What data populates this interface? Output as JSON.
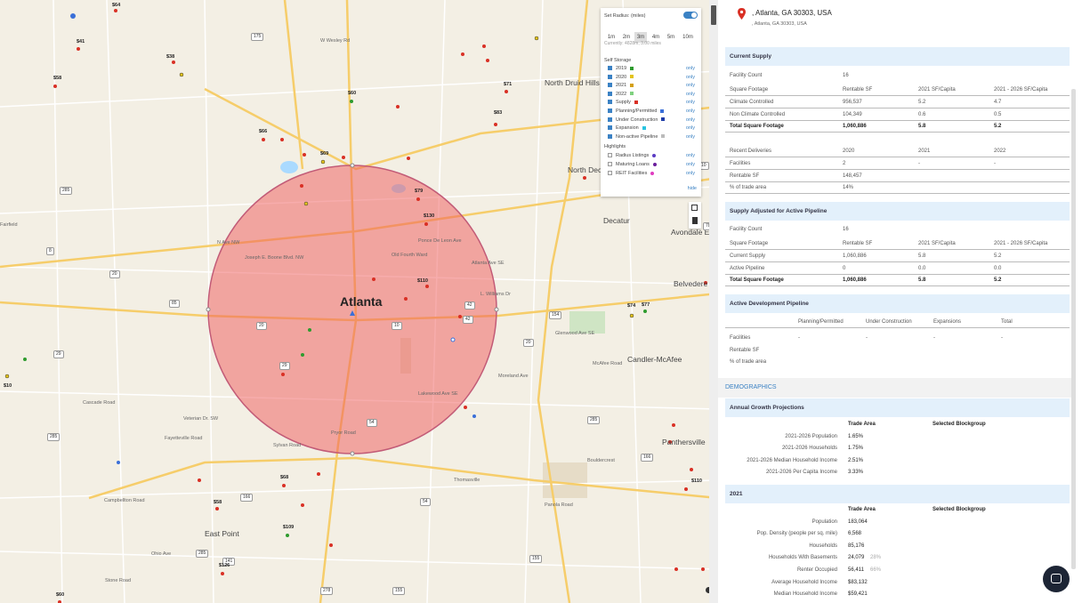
{
  "map": {
    "city_label": "Atlanta",
    "town_labels": [
      "North Druid Hills",
      "North Decat",
      "Decatur",
      "Avondale Estate",
      "Belvedere Park",
      "Candler-McAfee",
      "Panthersville",
      "East Point"
    ],
    "road_labels": [
      "W Wesley Rd",
      "N Ave NW",
      "Joseph E. Boone Blvd. NW",
      "Cascade Road",
      "Veterian Dr. SW",
      "Campbellton Road",
      "Stone Road",
      "Fairfield",
      "Lakewood Ave SE",
      "Ponce De Leon Ave",
      "Glenwood Ave SE",
      "McAfee Road",
      "Panola Road",
      "Atlanta Ave SE",
      "L. Williams Dr",
      "Old Fourth Ward",
      "Sylvan Road",
      "Pryor Road",
      "Thomasville",
      "Fayetteville Road",
      "Bouldercrest",
      "Moreland Ave",
      "Ohio Ave"
    ],
    "shields": [
      "175",
      "285",
      "285",
      "285",
      "10",
      "10",
      "29",
      "29",
      "166",
      "154",
      "54",
      "54",
      "155",
      "155",
      "166",
      "42",
      "20",
      "20",
      "141",
      "278",
      "78",
      "8",
      "85",
      "285",
      "20",
      "42"
    ],
    "price_labels": [
      "$64",
      "$41",
      "$38",
      "$60",
      "$66",
      "$69",
      "$58",
      "$83",
      "$71",
      "$79",
      "$130",
      "$110",
      "$74",
      "$77",
      "$68",
      "$58",
      "$109",
      "$126",
      "$10",
      "$110",
      "$60"
    ]
  },
  "controls": {
    "radius_label": "Set Radius: (miles)",
    "radius_options": [
      "1m",
      "2m",
      "3m",
      "4m",
      "5m",
      "10m"
    ],
    "radius_selected": "3m",
    "current_text": "Currently: 4828m, 3.00 miles",
    "self_storage_title": "Self Storage",
    "self_storage": [
      {
        "label": "2019",
        "color": "#2e9b2e",
        "checked": true
      },
      {
        "label": "2020",
        "color": "#e3c31c",
        "checked": true
      },
      {
        "label": "2021",
        "color": "#d4a017",
        "checked": true
      },
      {
        "label": "2022",
        "color": "#7fd17f",
        "checked": true
      },
      {
        "label": "Supply",
        "color": "#d93025",
        "checked": true
      },
      {
        "label": "Planning/Permitted",
        "color": "#3a6fd8",
        "checked": true
      },
      {
        "label": "Under Construction",
        "color": "#1e3ca8",
        "checked": true
      },
      {
        "label": "Expansion",
        "color": "#2ac4e0",
        "checked": true
      },
      {
        "label": "Non-active Pipeline",
        "color": "#bbbbbb",
        "checked": true
      }
    ],
    "highlights_title": "Highlights",
    "highlights": [
      {
        "label": "Radius Listings",
        "color": "#5b3cc4",
        "checked": false
      },
      {
        "label": "Maturing Loans",
        "color": "#6a1e9c",
        "checked": false
      },
      {
        "label": "REIT Facilities",
        "color": "#e03cc0",
        "checked": false
      }
    ],
    "only_label": "only",
    "hide_label": "hide"
  },
  "panel": {
    "address_title": ", Atlanta, GA 30303, USA",
    "address_sub": ", Atlanta, GA 30303, USA",
    "current_supply": {
      "title": "Current Supply",
      "facility_count_label": "Facility Count",
      "facility_count": "16",
      "cols": [
        "Square Footage",
        "Rentable SF",
        "2021 SF/Capita",
        "2021 - 2026 SF/Capita"
      ],
      "rows": [
        [
          "Climate Controlled",
          "956,537",
          "5.2",
          "4.7"
        ],
        [
          "Non Climate Controlled",
          "104,349",
          "0.6",
          "0.5"
        ],
        [
          "Total Square Footage",
          "1,060,886",
          "5.8",
          "5.2"
        ]
      ],
      "rd_cols": [
        "Recent Deliveries",
        "2020",
        "2021",
        "2022"
      ],
      "rd_rows": [
        [
          "Facilities",
          "2",
          "-",
          "-"
        ],
        [
          "Rentable SF",
          "148,457",
          "",
          ""
        ],
        [
          "% of trade area",
          "14%",
          "",
          ""
        ]
      ]
    },
    "adjusted": {
      "title": "Supply Adjusted for Active Pipeline",
      "facility_count_label": "Facility Count",
      "facility_count": "16",
      "cols": [
        "Square Footage",
        "Rentable SF",
        "2021 SF/Capita",
        "2021 - 2026 SF/Capita"
      ],
      "rows": [
        [
          "Current Supply",
          "1,060,886",
          "5.8",
          "5.2"
        ],
        [
          "Active Pipeline",
          "0",
          "0.0",
          "0.0"
        ],
        [
          "Total Square Footage",
          "1,060,886",
          "5.8",
          "5.2"
        ]
      ]
    },
    "pipeline": {
      "title": "Active Development Pipeline",
      "cols": [
        "Planning/Permitted",
        "Under Construction",
        "Expansions",
        "Total"
      ],
      "rows": [
        [
          "Facilities",
          "-",
          "-",
          "-",
          "-"
        ],
        [
          "Rentable SF",
          "",
          "",
          "",
          ""
        ],
        [
          "% of trade area",
          "",
          "",
          "",
          ""
        ]
      ]
    },
    "demographics_label": "DEMOGRAPHICS",
    "growth": {
      "title": "Annual Growth Projections",
      "cols": [
        "Trade Area",
        "Selected Blockgroup"
      ],
      "rows": [
        [
          "2021-2026 Population",
          "1.65%"
        ],
        [
          "2021-2026 Households",
          "1.75%"
        ],
        [
          "2021-2026 Median Household Income",
          "2.51%"
        ],
        [
          "2021-2026 Per Capita Income",
          "3.33%"
        ]
      ]
    },
    "y2021": {
      "title": "2021",
      "cols": [
        "Trade Area",
        "Selected Blockgroup"
      ],
      "rows": [
        [
          "Population",
          "183,064",
          ""
        ],
        [
          "Pop. Density (people per sq. mile)",
          "6,568",
          ""
        ],
        [
          "Households",
          "85,176",
          ""
        ],
        [
          "Households With Basements",
          "24,079",
          "28%"
        ],
        [
          "Renter Occupied",
          "56,411",
          "66%"
        ],
        [
          "Average Household Income",
          "$83,132",
          ""
        ],
        [
          "Median Household Income",
          "$59,421",
          ""
        ]
      ]
    }
  }
}
